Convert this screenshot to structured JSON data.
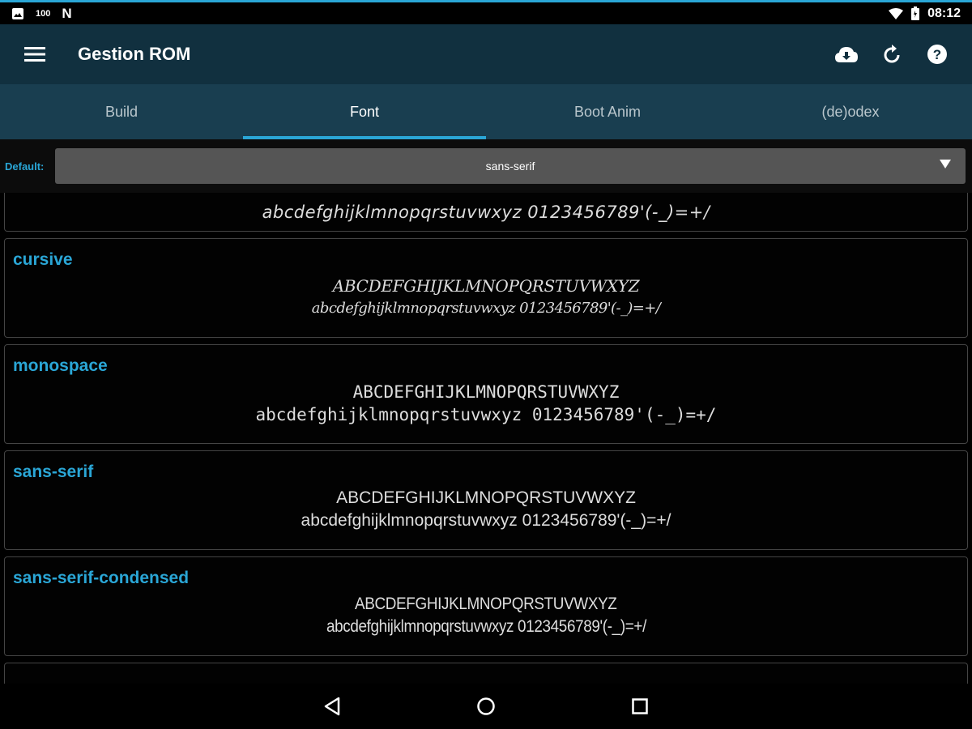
{
  "status_bar": {
    "left_icons": [
      "image-icon",
      "signal-text-icon",
      "n-icon"
    ],
    "signal_text": "100",
    "n_label": "N",
    "time": "08:12",
    "right_icons": [
      "wifi-icon",
      "battery-icon"
    ]
  },
  "app_bar": {
    "title": "Gestion ROM",
    "actions": [
      "cloud-download-icon",
      "refresh-icon",
      "help-icon"
    ]
  },
  "tabs": [
    {
      "label": "Build",
      "active": false
    },
    {
      "label": "Font",
      "active": true
    },
    {
      "label": "Boot Anim",
      "active": false
    },
    {
      "label": "(de)odex",
      "active": false
    }
  ],
  "default_selector": {
    "label": "Default:",
    "value": "sans-serif"
  },
  "fonts": {
    "partial_top_sample": "abcdefghijklmnopqrstuvwxyz 0123456789'(-_)=+/",
    "items": [
      {
        "name": "cursive",
        "upper": "ABCDEFGHIJKLMNOPQRSTUVWXYZ",
        "lower": "abcdefghijklmnopqrstuvwxyz 0123456789'(-_)=+/"
      },
      {
        "name": "monospace",
        "upper": "ABCDEFGHIJKLMNOPQRSTUVWXYZ",
        "lower": "abcdefghijklmnopqrstuvwxyz 0123456789'(-_)=+/"
      },
      {
        "name": "sans-serif",
        "upper": "ABCDEFGHIJKLMNOPQRSTUVWXYZ",
        "lower": "abcdefghijklmnopqrstuvwxyz 0123456789'(-_)=+/"
      },
      {
        "name": "sans-serif-condensed",
        "upper": "ABCDEFGHIJKLMNOPQRSTUVWXYZ",
        "lower": "abcdefghijklmnopqrstuvwxyz 0123456789'(-_)=+/"
      }
    ]
  },
  "nav_bar": [
    "back-icon",
    "home-icon",
    "recents-icon"
  ],
  "colors": {
    "accent": "#2aa6d6",
    "app_bar": "#11303f",
    "tab_bar": "#193e50",
    "select_bg": "#555555"
  }
}
